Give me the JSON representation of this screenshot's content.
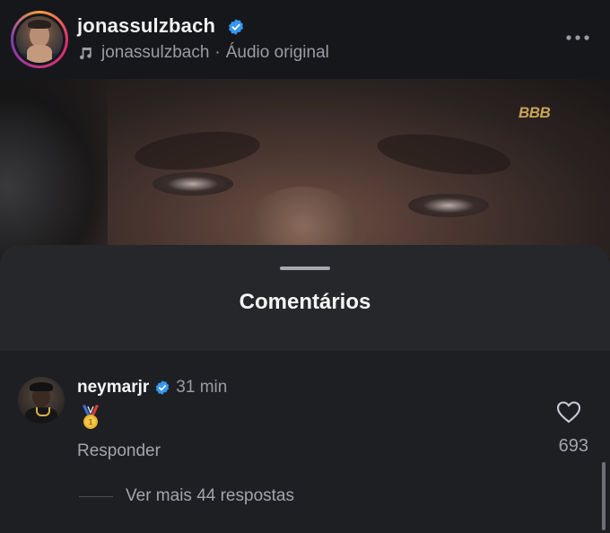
{
  "header": {
    "username": "jonassulzbach",
    "audio_owner": "jonassulzbach",
    "separator": "·",
    "audio_label": "Áudio original"
  },
  "video": {
    "watermark": "BBB"
  },
  "comments_sheet": {
    "title": "Comentários",
    "comments": [
      {
        "username": "neymarjr",
        "time": "31 min",
        "content": "🥇",
        "reply_label": "Responder",
        "likes": "693",
        "view_more": "Ver mais 44 respostas"
      }
    ]
  },
  "colors": {
    "background": "#1c1d21",
    "sheet": "#26272b",
    "verified_blue": "#3897f0",
    "secondary_text": "#a3a5ab"
  },
  "icons": [
    "verified-badge-icon",
    "music-note-icon",
    "more-options-icon",
    "gold-medal-icon",
    "heart-icon"
  ]
}
